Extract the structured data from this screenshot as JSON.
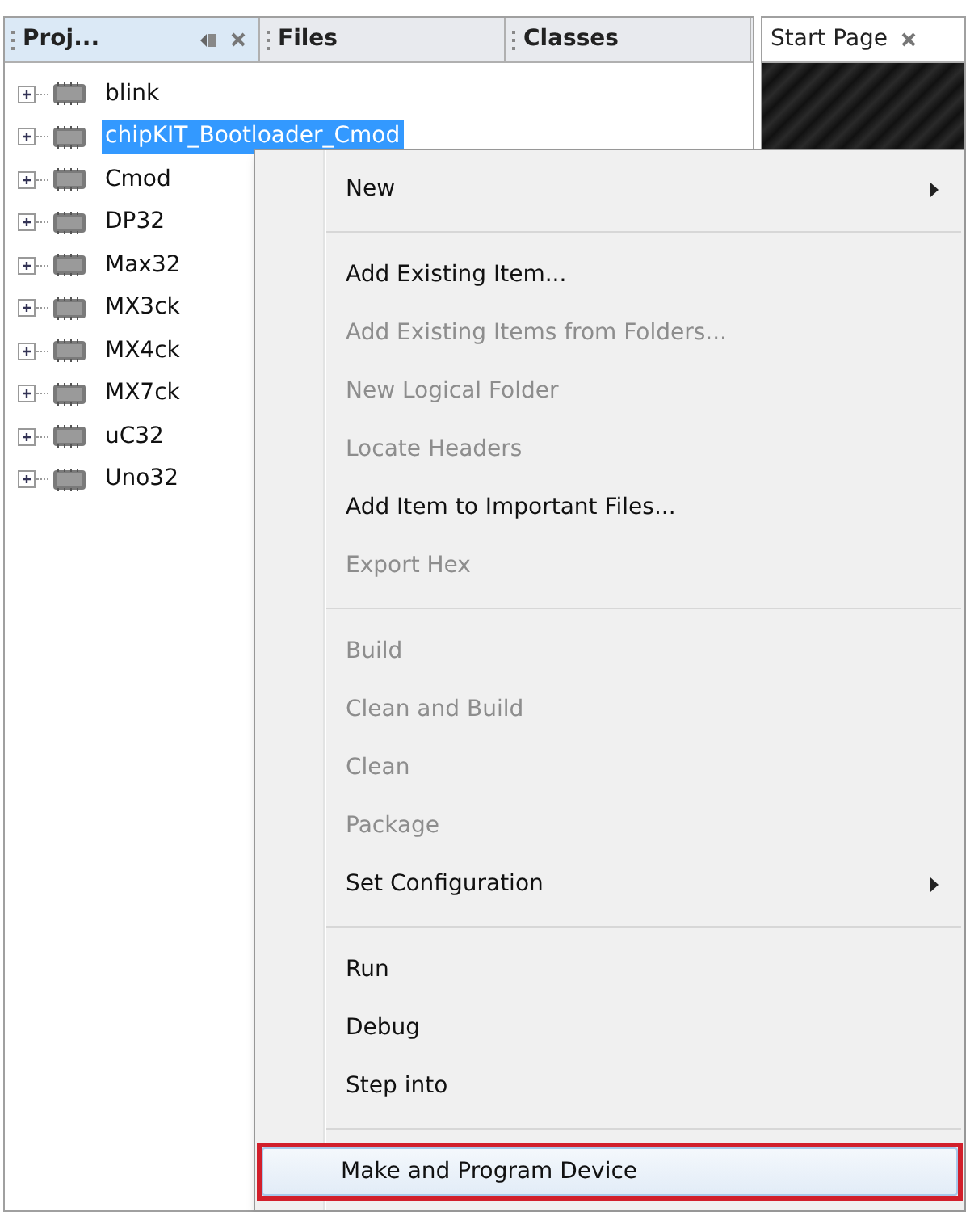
{
  "tabs": [
    {
      "label": "Proj...",
      "selected": true
    },
    {
      "label": "Files",
      "selected": false
    },
    {
      "label": "Classes",
      "selected": false
    }
  ],
  "editor_tab": {
    "label": "Start Page"
  },
  "tree": [
    {
      "label": "blink",
      "selected": false
    },
    {
      "label": "chipKIT_Bootloader_Cmod",
      "selected": true
    },
    {
      "label": "Cmod",
      "selected": false
    },
    {
      "label": "DP32",
      "selected": false
    },
    {
      "label": "Max32",
      "selected": false
    },
    {
      "label": "MX3ck",
      "selected": false
    },
    {
      "label": "MX4ck",
      "selected": false
    },
    {
      "label": "MX7ck",
      "selected": false
    },
    {
      "label": "uC32",
      "selected": false
    },
    {
      "label": "Uno32",
      "selected": false
    }
  ],
  "context_menu": [
    {
      "kind": "item",
      "label": "New",
      "disabled": false,
      "submenu": true,
      "selected": false,
      "callout": false
    },
    {
      "kind": "separator"
    },
    {
      "kind": "item",
      "label": "Add Existing Item...",
      "disabled": false,
      "submenu": false,
      "selected": false,
      "callout": false
    },
    {
      "kind": "item",
      "label": "Add Existing Items from Folders...",
      "disabled": true,
      "submenu": false,
      "selected": false,
      "callout": false
    },
    {
      "kind": "item",
      "label": "New Logical Folder",
      "disabled": true,
      "submenu": false,
      "selected": false,
      "callout": false
    },
    {
      "kind": "item",
      "label": "Locate Headers",
      "disabled": true,
      "submenu": false,
      "selected": false,
      "callout": false
    },
    {
      "kind": "item",
      "label": "Add Item to Important Files...",
      "disabled": false,
      "submenu": false,
      "selected": false,
      "callout": false
    },
    {
      "kind": "item",
      "label": "Export Hex",
      "disabled": true,
      "submenu": false,
      "selected": false,
      "callout": false
    },
    {
      "kind": "separator"
    },
    {
      "kind": "item",
      "label": "Build",
      "disabled": true,
      "submenu": false,
      "selected": false,
      "callout": false
    },
    {
      "kind": "item",
      "label": "Clean and Build",
      "disabled": true,
      "submenu": false,
      "selected": false,
      "callout": false
    },
    {
      "kind": "item",
      "label": "Clean",
      "disabled": true,
      "submenu": false,
      "selected": false,
      "callout": false
    },
    {
      "kind": "item",
      "label": "Package",
      "disabled": true,
      "submenu": false,
      "selected": false,
      "callout": false
    },
    {
      "kind": "item",
      "label": "Set Configuration",
      "disabled": false,
      "submenu": true,
      "selected": false,
      "callout": false
    },
    {
      "kind": "separator"
    },
    {
      "kind": "item",
      "label": "Run",
      "disabled": false,
      "submenu": false,
      "selected": false,
      "callout": false
    },
    {
      "kind": "item",
      "label": "Debug",
      "disabled": false,
      "submenu": false,
      "selected": false,
      "callout": false
    },
    {
      "kind": "item",
      "label": "Step into",
      "disabled": false,
      "submenu": false,
      "selected": false,
      "callout": false
    },
    {
      "kind": "separator"
    },
    {
      "kind": "item",
      "label": "Make and Program Device",
      "disabled": false,
      "submenu": false,
      "selected": true,
      "callout": true
    }
  ]
}
